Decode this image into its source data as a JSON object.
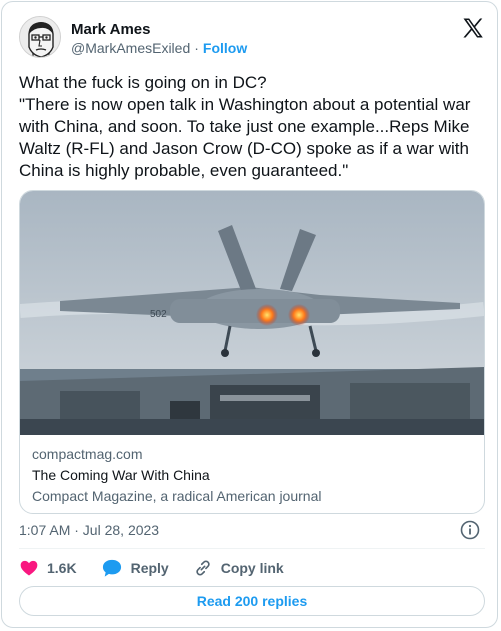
{
  "author": {
    "name": "Mark Ames",
    "handle": "@MarkAmesExiled",
    "separator": "·",
    "follow_label": "Follow"
  },
  "tweet": {
    "text": "What the fuck is going on in DC?\n\"There is now open talk in Washington about a potential war with China, and soon. To take just one example...Reps Mike Waltz (R-FL) and Jason Crow (D-CO) spoke as if a war with China is highly probable, even guaranteed.\"",
    "timestamp": "1:07 AM · Jul 28, 2023"
  },
  "link_card": {
    "domain": "compactmag.com",
    "title": "The Coming War With China",
    "description": "Compact Magazine, a radical American journal",
    "image_text": "502"
  },
  "actions": {
    "likes": "1.6K",
    "reply_label": "Reply",
    "copy_label": "Copy link"
  },
  "read_replies_label": "Read 200 replies",
  "colors": {
    "accent": "#1d9bf0",
    "like": "#f91880",
    "text": "#0f1419",
    "muted": "#536471"
  },
  "icons": [
    "x-logo-icon",
    "info-icon",
    "heart-icon",
    "reply-bubble-icon",
    "link-icon"
  ]
}
